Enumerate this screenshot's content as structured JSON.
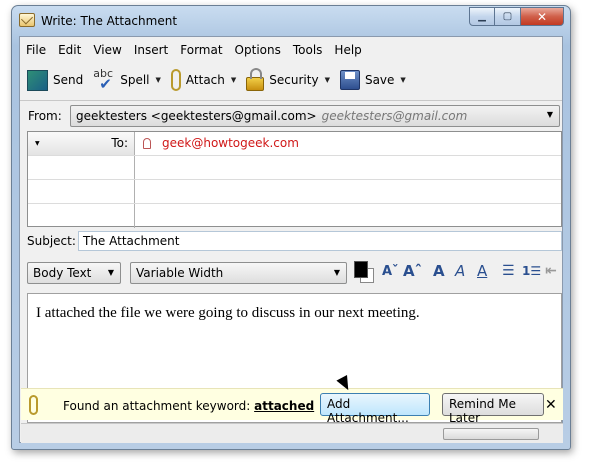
{
  "window": {
    "title": "Write: The Attachment",
    "min": "▁",
    "max": "▢",
    "close": "✕"
  },
  "menu": [
    "File",
    "Edit",
    "View",
    "Insert",
    "Format",
    "Options",
    "Tools",
    "Help"
  ],
  "toolbar": {
    "send": "Send",
    "spell": "Spell",
    "spell_icon_text": "abc",
    "attach": "Attach",
    "security": "Security",
    "save": "Save",
    "dropdown": "▼"
  },
  "from": {
    "label": "From:",
    "value": "geektesters <geektesters@gmail.com>",
    "secondary": "geektesters@gmail.com"
  },
  "recipients": [
    {
      "type": "To:",
      "address": "geek@howtogeek.com"
    }
  ],
  "subject": {
    "label": "Subject:",
    "value": "The Attachment"
  },
  "format": {
    "paragraph": "Body Text",
    "font": "Variable Width"
  },
  "body": {
    "text": "I attached the file we were going to discuss in our next meeting."
  },
  "notification": {
    "message": "Found an attachment keyword:",
    "keyword": "attached",
    "add_button": "Add Attachment...",
    "later_button": "Remind Me Later",
    "close": "✕"
  },
  "colors": {
    "accent": "#d01818",
    "notify_bg": "#ffffe1",
    "frame": "#b8cde5"
  },
  "icons": [
    "app-icon",
    "send-icon",
    "spell-icon",
    "attach-icon",
    "lock-icon",
    "save-icon",
    "paperclip-icon",
    "person-icon"
  ]
}
